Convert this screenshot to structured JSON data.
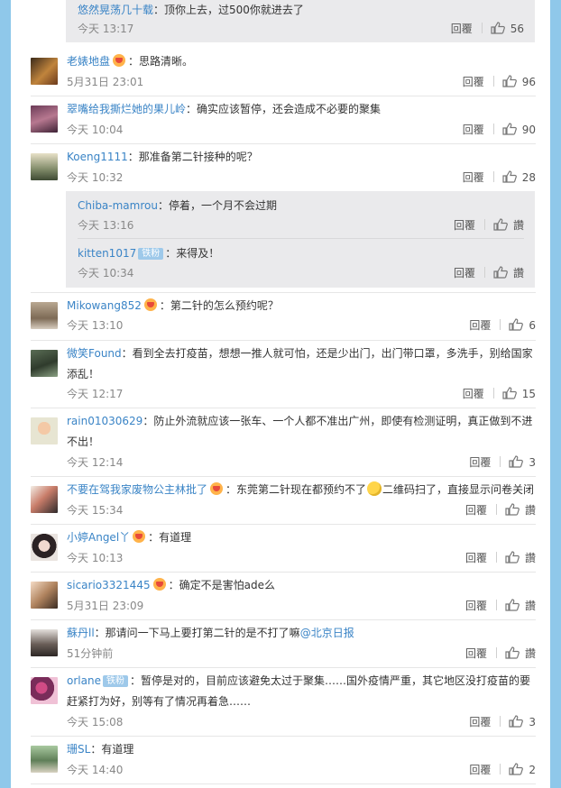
{
  "labels": {
    "reply": "回覆"
  },
  "top_reply": {
    "user": "悠然晃荡几十载",
    "text": "：顶你上去，过500你就进去了",
    "time": "今天 13:17",
    "likes": "56"
  },
  "comments": [
    {
      "user": "老婊地盘",
      "text": "：思路清晰。",
      "time": "5月31日 23:01",
      "likes": "96"
    },
    {
      "user": "翠嘴给我撕烂她的果儿岭",
      "text": "：确实应该暂停，还会造成不必要的聚集",
      "time": "今天 10:04",
      "likes": "90"
    },
    {
      "user": "Koeng1111",
      "text": "：那准备第二针接种的呢？",
      "time": "今天 10:32",
      "likes": "28"
    },
    {
      "user": "Mikowang852",
      "text": "：第二针的怎么预约呢？",
      "time": "今天 13:10",
      "likes": "6"
    },
    {
      "user": "微笑Found",
      "text": "：看到全去打疫苗，想想一推人就可怕，还是少出门，出门带口罩，多洗手，别给国家添乱！",
      "time": "今天 12:17",
      "likes": "15"
    },
    {
      "user": "rain01030629",
      "text": "：防止外流就应该一张车、一个人都不准出广州，即使有检测证明，真正做到不进不出！",
      "time": "今天 12:14",
      "likes": "3"
    },
    {
      "user": "不要在驾我家废物公主林批了",
      "text_a": "：东莞第二针现在都预约不了",
      "text_b": "二维码扫了，直接显示问卷关闭",
      "time": "今天 15:34",
      "likes": "讚"
    },
    {
      "user": "小婷Angel丫",
      "text": "：有道理",
      "time": "今天 10:13",
      "likes": "讚"
    },
    {
      "user": "sicario3321445",
      "text": "：确定不是害怕ade么",
      "time": "5月31日 23:09",
      "likes": "讚"
    },
    {
      "user": "蘇丹ll",
      "text": "：那请问一下马上要打第二针的是不打了嘛",
      "mention": "@北京日报",
      "time": "51分钟前",
      "likes": "讚"
    },
    {
      "user": "orlane",
      "badge": "铁粉",
      "text": "：暂停是对的，目前应该避免太过于聚集……国外疫情严重，其它地区没打疫苗的要赶紧打为好，别等有了情况再着急……",
      "time": "今天 15:08",
      "likes": "3"
    },
    {
      "user": "珊SL",
      "text": "：有道理",
      "time": "今天 14:40",
      "likes": "2"
    }
  ],
  "sub_replies": [
    {
      "user": "Chiba-mamrou",
      "text": "：停着，一个月不会过期",
      "time": "今天 13:16",
      "likes": "讚"
    },
    {
      "user": "kitten1017",
      "badge": "铁粉",
      "text": "：来得及！",
      "time": "今天 10:34",
      "likes": "讚"
    }
  ],
  "colors": {
    "link": "#3a84c6",
    "background": "#8fc8ea",
    "sub_bg": "#eaeaec"
  }
}
